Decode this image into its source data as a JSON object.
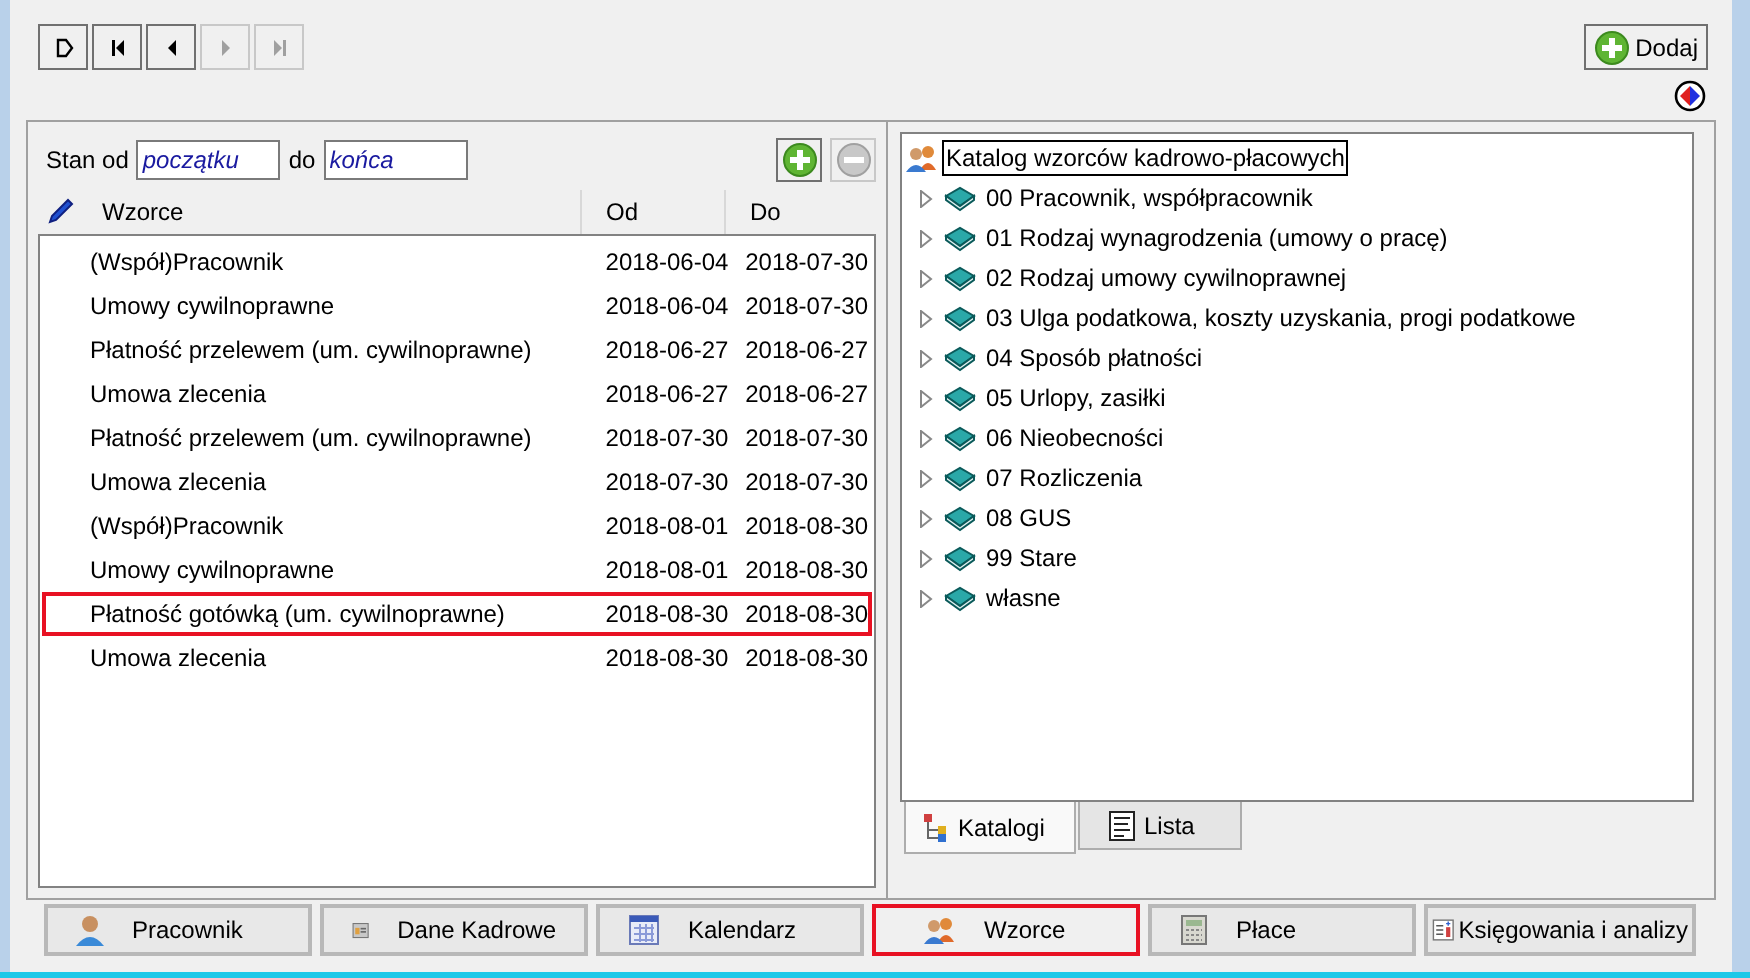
{
  "nav_buttons": [
    {
      "kind": "new",
      "disabled": false
    },
    {
      "kind": "first",
      "disabled": false
    },
    {
      "kind": "prev",
      "disabled": false
    },
    {
      "kind": "next",
      "disabled": true
    },
    {
      "kind": "last",
      "disabled": true
    }
  ],
  "add_button": {
    "label": "Dodaj"
  },
  "filter": {
    "from_label": "Stan od",
    "from_value": "początku",
    "to_label": "do",
    "to_value": "końca"
  },
  "table": {
    "columns": [
      "Wzorce",
      "Od",
      "Do"
    ],
    "rows": [
      {
        "name": "(Współ)Pracownik",
        "from": "2018-06-04",
        "to": "2018-07-30",
        "selected": false
      },
      {
        "name": "Umowy cywilnoprawne",
        "from": "2018-06-04",
        "to": "2018-07-30",
        "selected": false
      },
      {
        "name": "Płatność przelewem (um. cywilnoprawne)",
        "from": "2018-06-27",
        "to": "2018-06-27",
        "selected": false
      },
      {
        "name": "Umowa zlecenia",
        "from": "2018-06-27",
        "to": "2018-06-27",
        "selected": false
      },
      {
        "name": "Płatność przelewem (um. cywilnoprawne)",
        "from": "2018-07-30",
        "to": "2018-07-30",
        "selected": false
      },
      {
        "name": "Umowa zlecenia",
        "from": "2018-07-30",
        "to": "2018-07-30",
        "selected": false
      },
      {
        "name": "(Współ)Pracownik",
        "from": "2018-08-01",
        "to": "2018-08-30",
        "selected": false
      },
      {
        "name": "Umowy cywilnoprawne",
        "from": "2018-08-01",
        "to": "2018-08-30",
        "selected": false
      },
      {
        "name": "Płatność gotówką (um. cywilnoprawne)",
        "from": "2018-08-30",
        "to": "2018-08-30",
        "selected": true
      },
      {
        "name": "Umowa zlecenia",
        "from": "2018-08-30",
        "to": "2018-08-30",
        "selected": false
      }
    ]
  },
  "tree": {
    "root": "Katalog wzorców kadrowo-płacowych",
    "items": [
      {
        "label": "00 Pracownik, współpracownik",
        "expanded": false
      },
      {
        "label": "01 Rodzaj wynagrodzenia (umowy o pracę)",
        "expanded": false
      },
      {
        "label": "02 Rodzaj umowy cywilnoprawnej",
        "expanded": false
      },
      {
        "label": "03 Ulga podatkowa, koszty uzyskania, progi podatkowe",
        "expanded": false
      },
      {
        "label": "04 Sposób płatności",
        "expanded": false
      },
      {
        "label": "05 Urlopy, zasiłki",
        "expanded": false
      },
      {
        "label": "06 Nieobecności",
        "expanded": false
      },
      {
        "label": "07 Rozliczenia",
        "expanded": false
      },
      {
        "label": "08 GUS",
        "expanded": false
      },
      {
        "label": "99 Stare",
        "expanded": false
      },
      {
        "label": "własne",
        "expanded": false
      }
    ]
  },
  "view_tabs": [
    {
      "label": "Katalogi",
      "kind": "tree",
      "selected": true
    },
    {
      "label": "Lista",
      "kind": "list",
      "selected": false
    }
  ],
  "module_tabs": [
    {
      "label": "Pracownik",
      "kind": "person",
      "selected": false
    },
    {
      "label": "Dane Kadrowe",
      "kind": "card",
      "selected": false
    },
    {
      "label": "Kalendarz",
      "kind": "calendar",
      "selected": false
    },
    {
      "label": "Wzorce",
      "kind": "people",
      "selected": true
    },
    {
      "label": "Płace",
      "kind": "calculator",
      "selected": false
    },
    {
      "label": "Księgowania i analizy",
      "kind": "report",
      "selected": false
    }
  ]
}
